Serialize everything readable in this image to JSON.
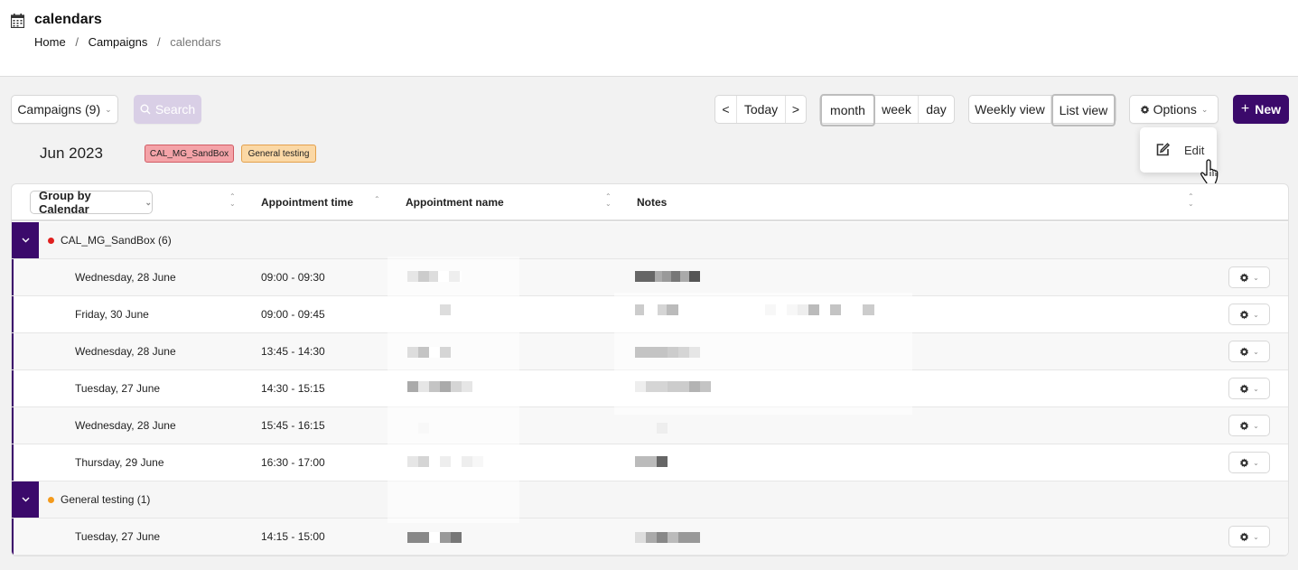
{
  "header": {
    "title": "calendars",
    "breadcrumb": [
      "Home",
      "Campaigns",
      "calendars"
    ]
  },
  "toolbar": {
    "campaigns_label": "Campaigns (9)",
    "search_label": "Search",
    "prev_label": "<",
    "today_label": "Today",
    "next_label": ">",
    "views": [
      "month",
      "week",
      "day"
    ],
    "active_view": "month",
    "weekly_view_label": "Weekly view",
    "list_view_label": "List view",
    "options_label": "Options",
    "new_label": "New"
  },
  "options_menu": {
    "edit_label": "Edit"
  },
  "period_label": "Jun 2023",
  "calendar_tags": [
    {
      "label": "CAL_MG_SandBox",
      "color": "#f4a3a8"
    },
    {
      "label": "General testing",
      "color": "#fbd8a5"
    }
  ],
  "table": {
    "group_by_label": "Group by Calendar",
    "columns": [
      "Appointment time",
      "Appointment name",
      "Notes"
    ],
    "groups": [
      {
        "label": "CAL_MG_SandBox (6)",
        "color": "#e0201f",
        "rows": [
          {
            "date": "Wednesday, 28 June",
            "time": "09:00 - 09:30"
          },
          {
            "date": "Friday, 30 June",
            "time": "09:00 - 09:45"
          },
          {
            "date": "Wednesday, 28 June",
            "time": "13:45 - 14:30"
          },
          {
            "date": "Tuesday, 27 June",
            "time": "14:30 - 15:15"
          },
          {
            "date": "Wednesday, 28 June",
            "time": "15:45 - 16:15"
          },
          {
            "date": "Thursday, 29 June",
            "time": "16:30 - 17:00"
          }
        ]
      },
      {
        "label": "General testing (1)",
        "color": "#f39a1c",
        "rows": [
          {
            "date": "Tuesday, 27 June",
            "time": "14:15 - 15:00"
          }
        ]
      }
    ]
  },
  "colors": {
    "accent": "#3b0a6b",
    "search_disabled": "#d9cfe6"
  }
}
